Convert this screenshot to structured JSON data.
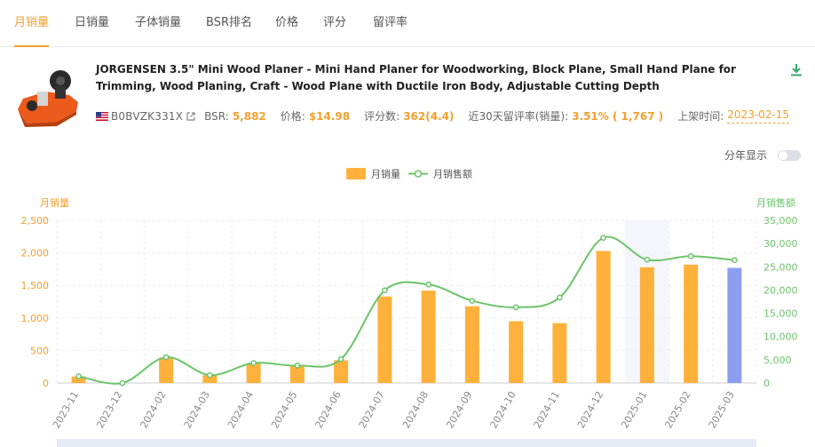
{
  "tabs": [
    {
      "label": "月销量",
      "active": true
    },
    {
      "label": "日销量",
      "active": false
    },
    {
      "label": "子体销量",
      "active": false
    },
    {
      "label": "BSR排名",
      "active": false
    },
    {
      "label": "价格",
      "active": false
    },
    {
      "label": "评分",
      "active": false
    },
    {
      "label": "留评率",
      "active": false
    }
  ],
  "product": {
    "title": "JORGENSEN 3.5\" Mini Wood Planer - Mini Hand Planer for Woodworking, Block Plane, Small Hand Plane for Trimming, Wood Planing, Craft - Wood Plane with Ductile Iron Body, Adjustable Cutting Depth",
    "asin": "B0BVZK331X",
    "bsr_label": "BSR:",
    "bsr_value": "5,882",
    "price_label": "价格:",
    "price_value": "$14.98",
    "rating_label": "评分数:",
    "rating_value": "362(4.4)",
    "review_rate_label": "近30天留评率(销量):",
    "review_rate_value": "3.51% ( 1,767 )",
    "listed_label": "上架时间:",
    "listed_value": "2023-02-15"
  },
  "toggle": {
    "label": "分年显示",
    "on": false
  },
  "colors": {
    "accent": "#f0a030",
    "bar": "#ffb13b",
    "bar_highlight": "#8d9ef0",
    "line": "#6cc46a",
    "hover_band": "#f4f6fb"
  },
  "chart_data": {
    "type": "bar",
    "categories": [
      "2023-11",
      "2023-12",
      "2024-02",
      "2024-03",
      "2024-04",
      "2024-05",
      "2024-06",
      "2024-07",
      "2024-08",
      "2024-09",
      "2024-10",
      "2024-11",
      "2024-12",
      "2025-01",
      "2025-02",
      "2025-03"
    ],
    "series": [
      {
        "name": "月销量",
        "type": "bar",
        "axis": "left",
        "values": [
          100,
          0,
          390,
          120,
          300,
          260,
          350,
          1330,
          1420,
          1180,
          950,
          920,
          2030,
          1780,
          1820,
          1770
        ]
      },
      {
        "name": "月销售额",
        "type": "line",
        "axis": "right",
        "values": [
          1450,
          0,
          5550,
          1700,
          4300,
          3750,
          5150,
          19950,
          21200,
          17700,
          16300,
          18400,
          31250,
          26550,
          27300,
          26450
        ]
      }
    ],
    "ylabel": "月销量",
    "y2label": "月销售额",
    "ylim": [
      0,
      2500
    ],
    "y2lim": [
      0,
      35000
    ],
    "yticks": [
      "0",
      "500",
      "1,000",
      "1,500",
      "2,000",
      "2,500"
    ],
    "y2ticks": [
      "0",
      "5,000",
      "10,000",
      "15,000",
      "20,000",
      "25,000",
      "30,000",
      "35,000"
    ],
    "highlight_index": 15,
    "hover_index": 13,
    "legend_position": "top-center",
    "grid": true
  }
}
